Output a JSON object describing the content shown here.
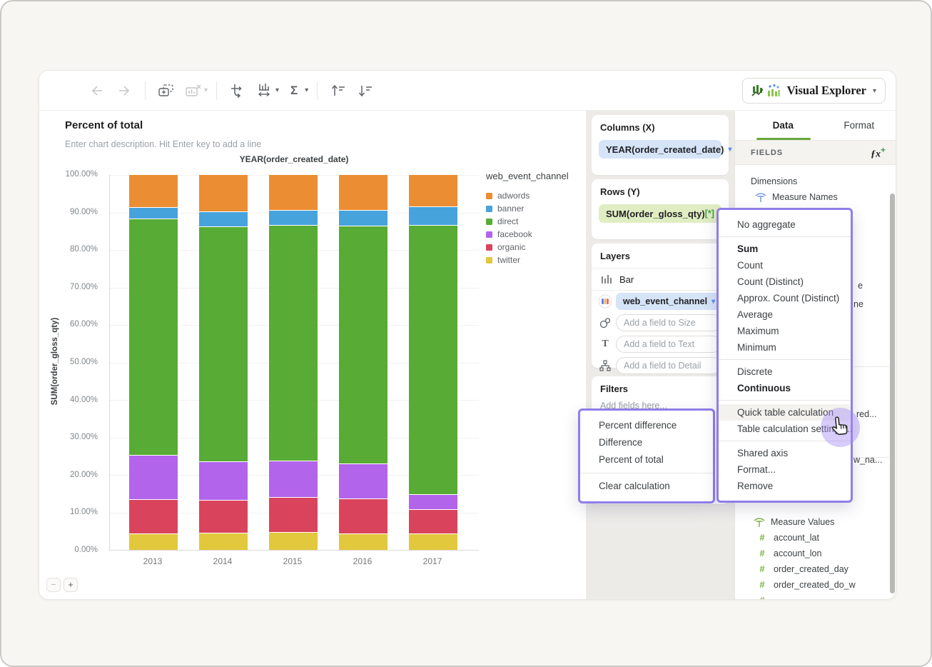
{
  "window": {
    "app_button": {
      "label": "Visual Explorer"
    }
  },
  "controls": {
    "zoom_out": "−",
    "zoom_in": "+"
  },
  "icons": {
    "caret": "▾",
    "sigma": "Σ",
    "text_tool": "T",
    "fx": "ƒx",
    "fx_plus": "+",
    "hash": "#"
  },
  "chart": {
    "title": "Percent of total",
    "description_placeholder": "Enter chart description. Hit Enter key to add a line",
    "x_axis_title": "YEAR(order_created_date)",
    "y_axis_title": "SUM(order_gloss_qty)",
    "y_ticks": [
      "100.00%",
      "90.00%",
      "80.00%",
      "70.00%",
      "60.00%",
      "50.00%",
      "40.00%",
      "30.00%",
      "20.00%",
      "10.00%",
      "0.00%"
    ]
  },
  "chart_data": {
    "type": "bar",
    "stacked": true,
    "title": "Percent of total",
    "xlabel": "YEAR(order_created_date)",
    "ylabel": "SUM(order_gloss_qty)",
    "ylim": [
      0,
      100
    ],
    "y_unit": "percent",
    "grid": true,
    "legend_position": "right",
    "legend_title": "web_event_channel",
    "categories": [
      "2013",
      "2014",
      "2015",
      "2016",
      "2017"
    ],
    "series": [
      {
        "name": "twitter",
        "color": "#E2C83C",
        "values": [
          4.3,
          4.6,
          4.8,
          4.3,
          4.3
        ]
      },
      {
        "name": "organic",
        "color": "#D9445C",
        "values": [
          9.3,
          8.8,
          9.3,
          9.4,
          6.6
        ]
      },
      {
        "name": "facebook",
        "color": "#B264EA",
        "values": [
          11.8,
          10.3,
          9.8,
          9.4,
          3.9
        ]
      },
      {
        "name": "direct",
        "color": "#58AB34",
        "values": [
          62.9,
          62.5,
          62.8,
          63.3,
          71.8
        ]
      },
      {
        "name": "banner",
        "color": "#47A3DB",
        "values": [
          3.1,
          4.0,
          4.0,
          4.2,
          5.1
        ]
      },
      {
        "name": "adwords",
        "color": "#EB8D33",
        "values": [
          8.6,
          9.8,
          9.3,
          9.4,
          8.3
        ]
      }
    ],
    "legend": [
      {
        "label": "adwords",
        "color": "#EB8D33"
      },
      {
        "label": "banner",
        "color": "#47A3DB"
      },
      {
        "label": "direct",
        "color": "#58AB34"
      },
      {
        "label": "facebook",
        "color": "#B264EA"
      },
      {
        "label": "organic",
        "color": "#D9445C"
      },
      {
        "label": "twitter",
        "color": "#E2C83C"
      }
    ]
  },
  "shelves": {
    "columns": {
      "title": "Columns (X)",
      "pill": "YEAR(order_created_date)"
    },
    "rows": {
      "title": "Rows (Y)",
      "pill": "SUM(order_gloss_qty)",
      "pill_badge": "[*]"
    },
    "layers": {
      "title": "Layers",
      "type_label": "Bar",
      "color_field": "web_event_channel",
      "size_placeholder": "Add a field to Size",
      "text_placeholder": "Add a field to Text",
      "detail_placeholder": "Add a field to Detail"
    },
    "filters": {
      "title": "Filters",
      "placeholder": "Add fields here..."
    }
  },
  "sidebar": {
    "tabs": [
      "Data",
      "Format"
    ],
    "fields_header": "FIELDS",
    "dimensions_label": "Dimensions",
    "top_items": [
      "Measure Names"
    ],
    "clipped_items": [
      "e",
      "ne",
      "red...",
      "w_na..."
    ],
    "bottom_items": [
      "Measure Values",
      "account_lat",
      "account_lon",
      "order_created_day",
      "order_created_do_w"
    ]
  },
  "menus": {
    "calc_menu": {
      "items": [
        {
          "label": "Percent difference"
        },
        {
          "label": "Difference"
        },
        {
          "label": "Percent of total"
        },
        {
          "divider": true
        },
        {
          "label": "Clear calculation"
        }
      ]
    },
    "field_menu": {
      "items": [
        {
          "label": "No aggregate"
        },
        {
          "divider": true
        },
        {
          "label": "Sum",
          "bold": true
        },
        {
          "label": "Count"
        },
        {
          "label": "Count (Distinct)"
        },
        {
          "label": "Approx. Count (Distinct)"
        },
        {
          "label": "Average"
        },
        {
          "label": "Maximum"
        },
        {
          "label": "Minimum"
        },
        {
          "divider": true
        },
        {
          "label": "Discrete"
        },
        {
          "label": "Continuous",
          "bold": true
        },
        {
          "divider": true
        },
        {
          "label": "Quick table calculation",
          "hover": true
        },
        {
          "label": "Table calculation settings..."
        },
        {
          "divider": true
        },
        {
          "label": "Shared axis"
        },
        {
          "label": "Format..."
        },
        {
          "label": "Remove"
        }
      ]
    }
  },
  "colors": {
    "menu_border": "#8F7EE9",
    "tab_active_underline": "#69A73B",
    "columns_pill_bg": "#D6E4F8",
    "rows_pill_bg": "#E0EDC2",
    "badge_green": "#43A047",
    "cursor_halo": "#A78FF5"
  }
}
